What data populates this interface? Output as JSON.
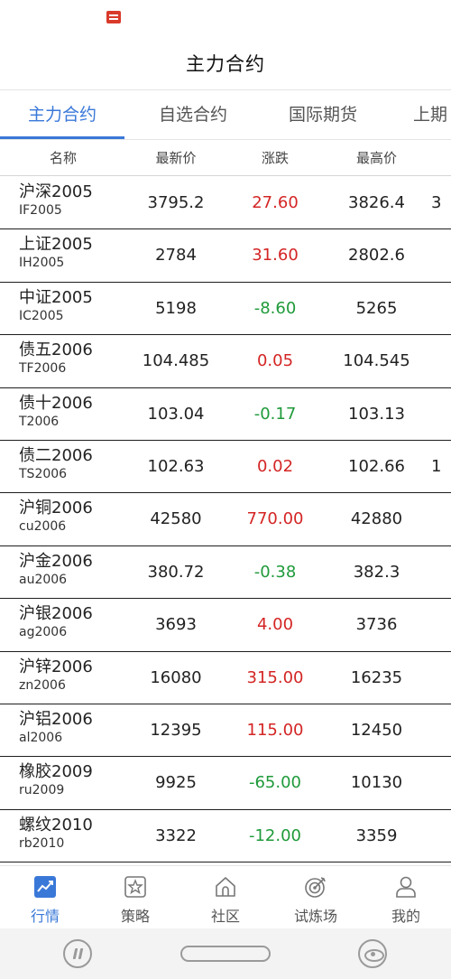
{
  "header": {
    "title": "主力合约"
  },
  "tabs": [
    {
      "label": "主力合约",
      "active": true
    },
    {
      "label": "自选合约",
      "active": false
    },
    {
      "label": "国际期货",
      "active": false
    },
    {
      "label": "上期",
      "active": false
    }
  ],
  "table": {
    "columns": [
      "名称",
      "最新价",
      "涨跌",
      "最高价"
    ],
    "rows": [
      {
        "name": "沪深2005",
        "code": "IF2005",
        "price": "3795.2",
        "change": "27.60",
        "direction": "up",
        "high": "3826.4",
        "next": "3"
      },
      {
        "name": "上证2005",
        "code": "IH2005",
        "price": "2784",
        "change": "31.60",
        "direction": "up",
        "high": "2802.6",
        "next": ""
      },
      {
        "name": "中证2005",
        "code": "IC2005",
        "price": "5198",
        "change": "-8.60",
        "direction": "down",
        "high": "5265",
        "next": ""
      },
      {
        "name": "债五2006",
        "code": "TF2006",
        "price": "104.485",
        "change": "0.05",
        "direction": "up",
        "high": "104.545",
        "next": ""
      },
      {
        "name": "债十2006",
        "code": "T2006",
        "price": "103.04",
        "change": "-0.17",
        "direction": "down",
        "high": "103.13",
        "next": ""
      },
      {
        "name": "债二2006",
        "code": "TS2006",
        "price": "102.63",
        "change": "0.02",
        "direction": "up",
        "high": "102.66",
        "next": "1"
      },
      {
        "name": "沪铜2006",
        "code": "cu2006",
        "price": "42580",
        "change": "770.00",
        "direction": "up",
        "high": "42880",
        "next": ""
      },
      {
        "name": "沪金2006",
        "code": "au2006",
        "price": "380.72",
        "change": "-0.38",
        "direction": "down",
        "high": "382.3",
        "next": ""
      },
      {
        "name": "沪银2006",
        "code": "ag2006",
        "price": "3693",
        "change": "4.00",
        "direction": "up",
        "high": "3736",
        "next": ""
      },
      {
        "name": "沪锌2006",
        "code": "zn2006",
        "price": "16080",
        "change": "315.00",
        "direction": "up",
        "high": "16235",
        "next": ""
      },
      {
        "name": "沪铝2006",
        "code": "al2006",
        "price": "12395",
        "change": "115.00",
        "direction": "up",
        "high": "12450",
        "next": ""
      },
      {
        "name": "橡胶2009",
        "code": "ru2009",
        "price": "9925",
        "change": "-65.00",
        "direction": "down",
        "high": "10130",
        "next": ""
      },
      {
        "name": "螺纹2010",
        "code": "rb2010",
        "price": "3322",
        "change": "-12.00",
        "direction": "down",
        "high": "3359",
        "next": ""
      }
    ]
  },
  "bottom_nav": [
    {
      "label": "行情",
      "icon": "chart-icon",
      "active": true
    },
    {
      "label": "策略",
      "icon": "star-icon",
      "active": false
    },
    {
      "label": "社区",
      "icon": "home-icon",
      "active": false
    },
    {
      "label": "试炼场",
      "icon": "target-icon",
      "active": false
    },
    {
      "label": "我的",
      "icon": "user-icon",
      "active": false
    }
  ],
  "colors": {
    "accent": "#3a78d8",
    "up": "#d42525",
    "down": "#1f9a3a"
  }
}
